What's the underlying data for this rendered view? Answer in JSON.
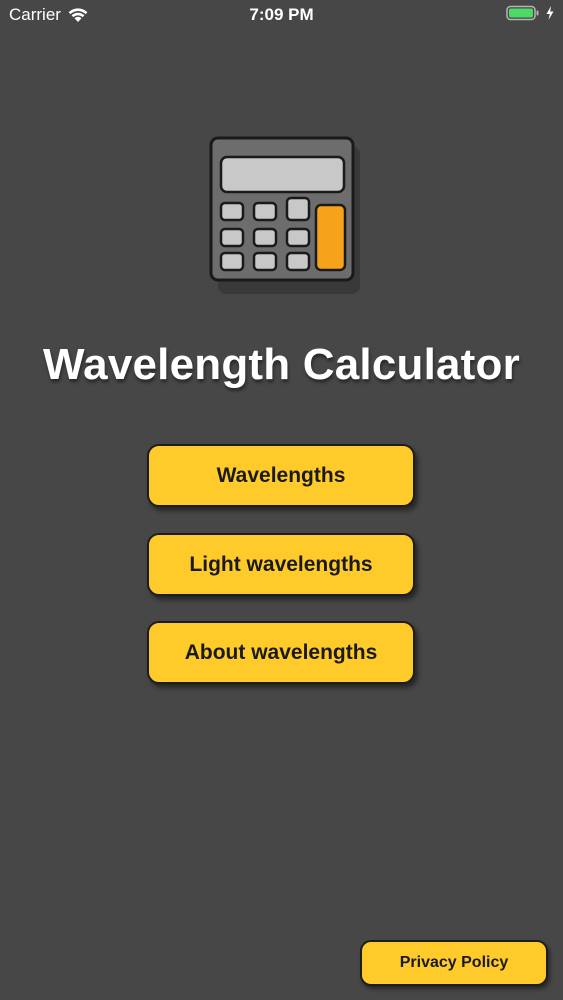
{
  "status_bar": {
    "carrier": "Carrier",
    "time": "7:09 PM",
    "battery_color": "#4cd964"
  },
  "app": {
    "title": "Wavelength Calculator",
    "icon": "calculator-icon"
  },
  "menu": {
    "buttons": [
      {
        "label": "Wavelengths"
      },
      {
        "label": "Light wavelengths"
      },
      {
        "label": "About wavelengths"
      }
    ]
  },
  "footer": {
    "privacy_label": "Privacy Policy"
  },
  "colors": {
    "background": "#474747",
    "button": "#fecb2a",
    "calculator_accent": "#f7a21b"
  }
}
